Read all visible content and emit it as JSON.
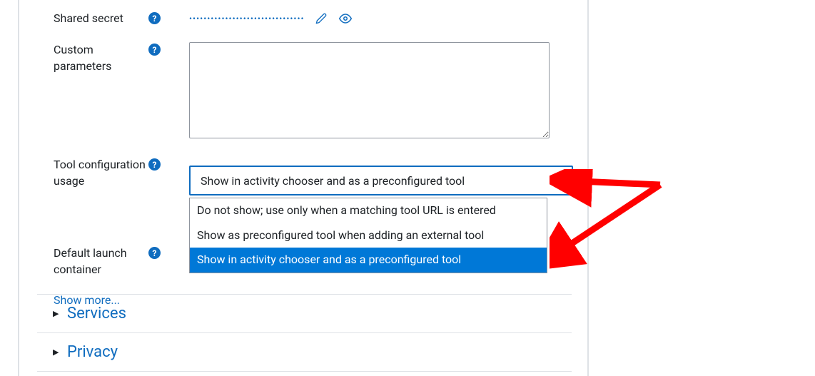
{
  "fields": {
    "shared_secret": {
      "label": "Shared secret",
      "masked_value": "••••••••••••••••••••••••••••••••"
    },
    "custom_parameters": {
      "label": "Custom parameters",
      "value": ""
    },
    "tool_configuration_usage": {
      "label": "Tool configuration usage",
      "selected": "Show in activity chooser and as a preconfigured tool",
      "options": [
        "Do not show; use only when a matching tool URL is entered",
        "Show as preconfigured tool when adding an external tool",
        "Show in activity chooser and as a preconfigured tool"
      ]
    },
    "default_launch_container": {
      "label": "Default launch container"
    }
  },
  "links": {
    "show_more": "Show more..."
  },
  "accordion": {
    "services": "Services",
    "privacy": "Privacy"
  },
  "colors": {
    "link": "#0f6cbf",
    "highlight": "#0078d7",
    "arrow": "#ff0000",
    "border": "#dee2e6"
  }
}
